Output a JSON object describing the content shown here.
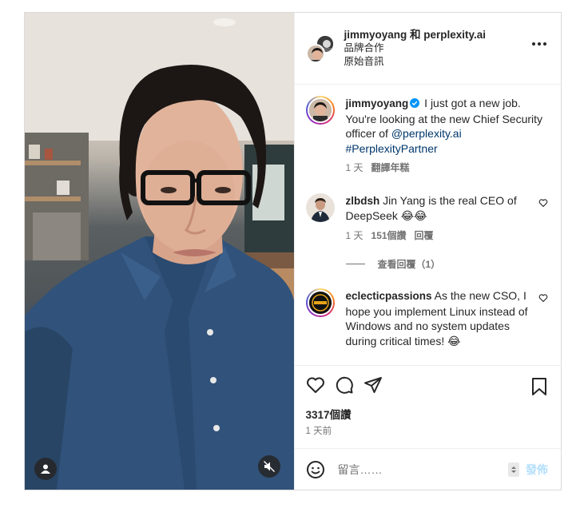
{
  "header": {
    "names": "jimmyoyang 和 perplexity.ai",
    "partnership": "品牌合作",
    "audio": "原始音訊"
  },
  "caption": {
    "user": "jimmyoyang",
    "text_1": " I just got a new job. You're looking at the new Chief Security officer of ",
    "mention": "@perplexity.ai",
    "hashtag": "#PerplexityPartner",
    "time": "1 天",
    "translate": "翻譯年糕"
  },
  "comments": [
    {
      "user": "zlbdsh",
      "text": " Jin Yang is the real CEO of DeepSeek 😂😂",
      "time": "1 天",
      "likes": "151個讚",
      "reply": "回覆",
      "view_replies": "查看回覆（1）"
    },
    {
      "user": "eclecticpassions",
      "text": " As the new CSO, I hope you implement Linux instead of Windows and no system updates during critical times! 😂"
    }
  ],
  "stats": {
    "likes": "3317個讚",
    "posted": "1 天前"
  },
  "composer": {
    "placeholder": "留言……",
    "post": "發佈"
  },
  "icons": {
    "like": "heart-icon",
    "comment": "comment-icon",
    "share": "paper-plane-icon",
    "save": "bookmark-icon",
    "emoji": "smiley-icon",
    "more": "more-horizontal-icon",
    "mute": "speaker-muted-icon",
    "tagged": "user-icon"
  },
  "colors": {
    "link": "#00376b",
    "verified": "#0095f6",
    "post_disabled": "#b2dffc"
  }
}
